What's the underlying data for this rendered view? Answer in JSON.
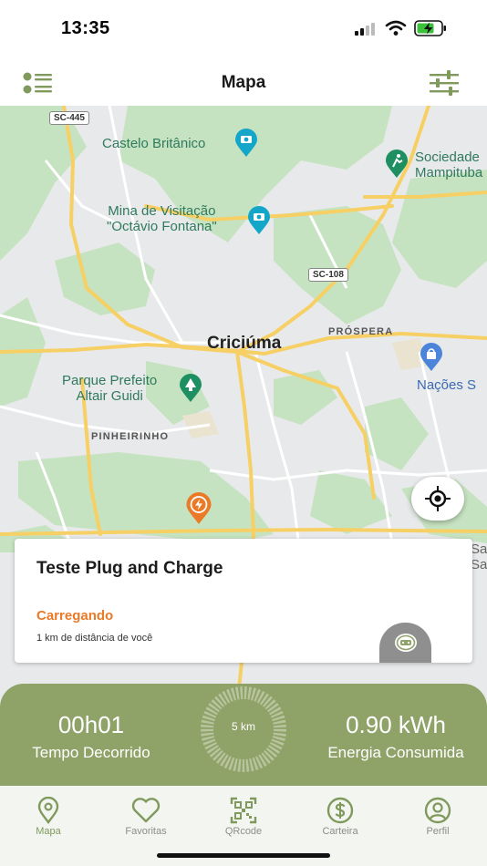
{
  "status_bar": {
    "time": "13:35"
  },
  "header": {
    "title": "Mapa"
  },
  "map": {
    "roads": [
      "SC-445",
      "SC-108"
    ],
    "pois": [
      {
        "label": "Castelo Britânico",
        "icon": "camera-icon"
      },
      {
        "label": "Sociedade\nMampituba",
        "icon": "sport-icon"
      },
      {
        "label": "Mina de Visitação\n\"Octávio Fontana\"",
        "icon": "camera-icon"
      },
      {
        "label": "Parque Prefeito\nAltair Guidi",
        "icon": "tree-icon"
      },
      {
        "label": "Nações S",
        "icon": "shopping-icon"
      }
    ],
    "city": "Criciúma",
    "districts": [
      "PRÓSPERA",
      "PINHEIRINHO"
    ],
    "edge_text": "Sa\nSa"
  },
  "station": {
    "name": "Teste Plug and Charge",
    "status": "Carregando",
    "distance": "1 km de distância de você"
  },
  "session": {
    "time": "00h01",
    "time_label": "Tempo Decorrido",
    "radius": "5 km",
    "energy": "0.90 kWh",
    "energy_label": "Energia Consumida"
  },
  "nav": [
    {
      "label": "Mapa",
      "icon": "map-pin-icon",
      "active": true
    },
    {
      "label": "Favoritas",
      "icon": "heart-icon",
      "active": false
    },
    {
      "label": "QRcode",
      "icon": "qrcode-icon",
      "active": false
    },
    {
      "label": "Carteira",
      "icon": "dollar-icon",
      "active": false
    },
    {
      "label": "Perfil",
      "icon": "user-icon",
      "active": false
    }
  ],
  "colors": {
    "accent": "#8fa369",
    "status_orange": "#ea7a28",
    "map_green": "#c5e3c0",
    "road_yellow": "#f6cf65"
  }
}
